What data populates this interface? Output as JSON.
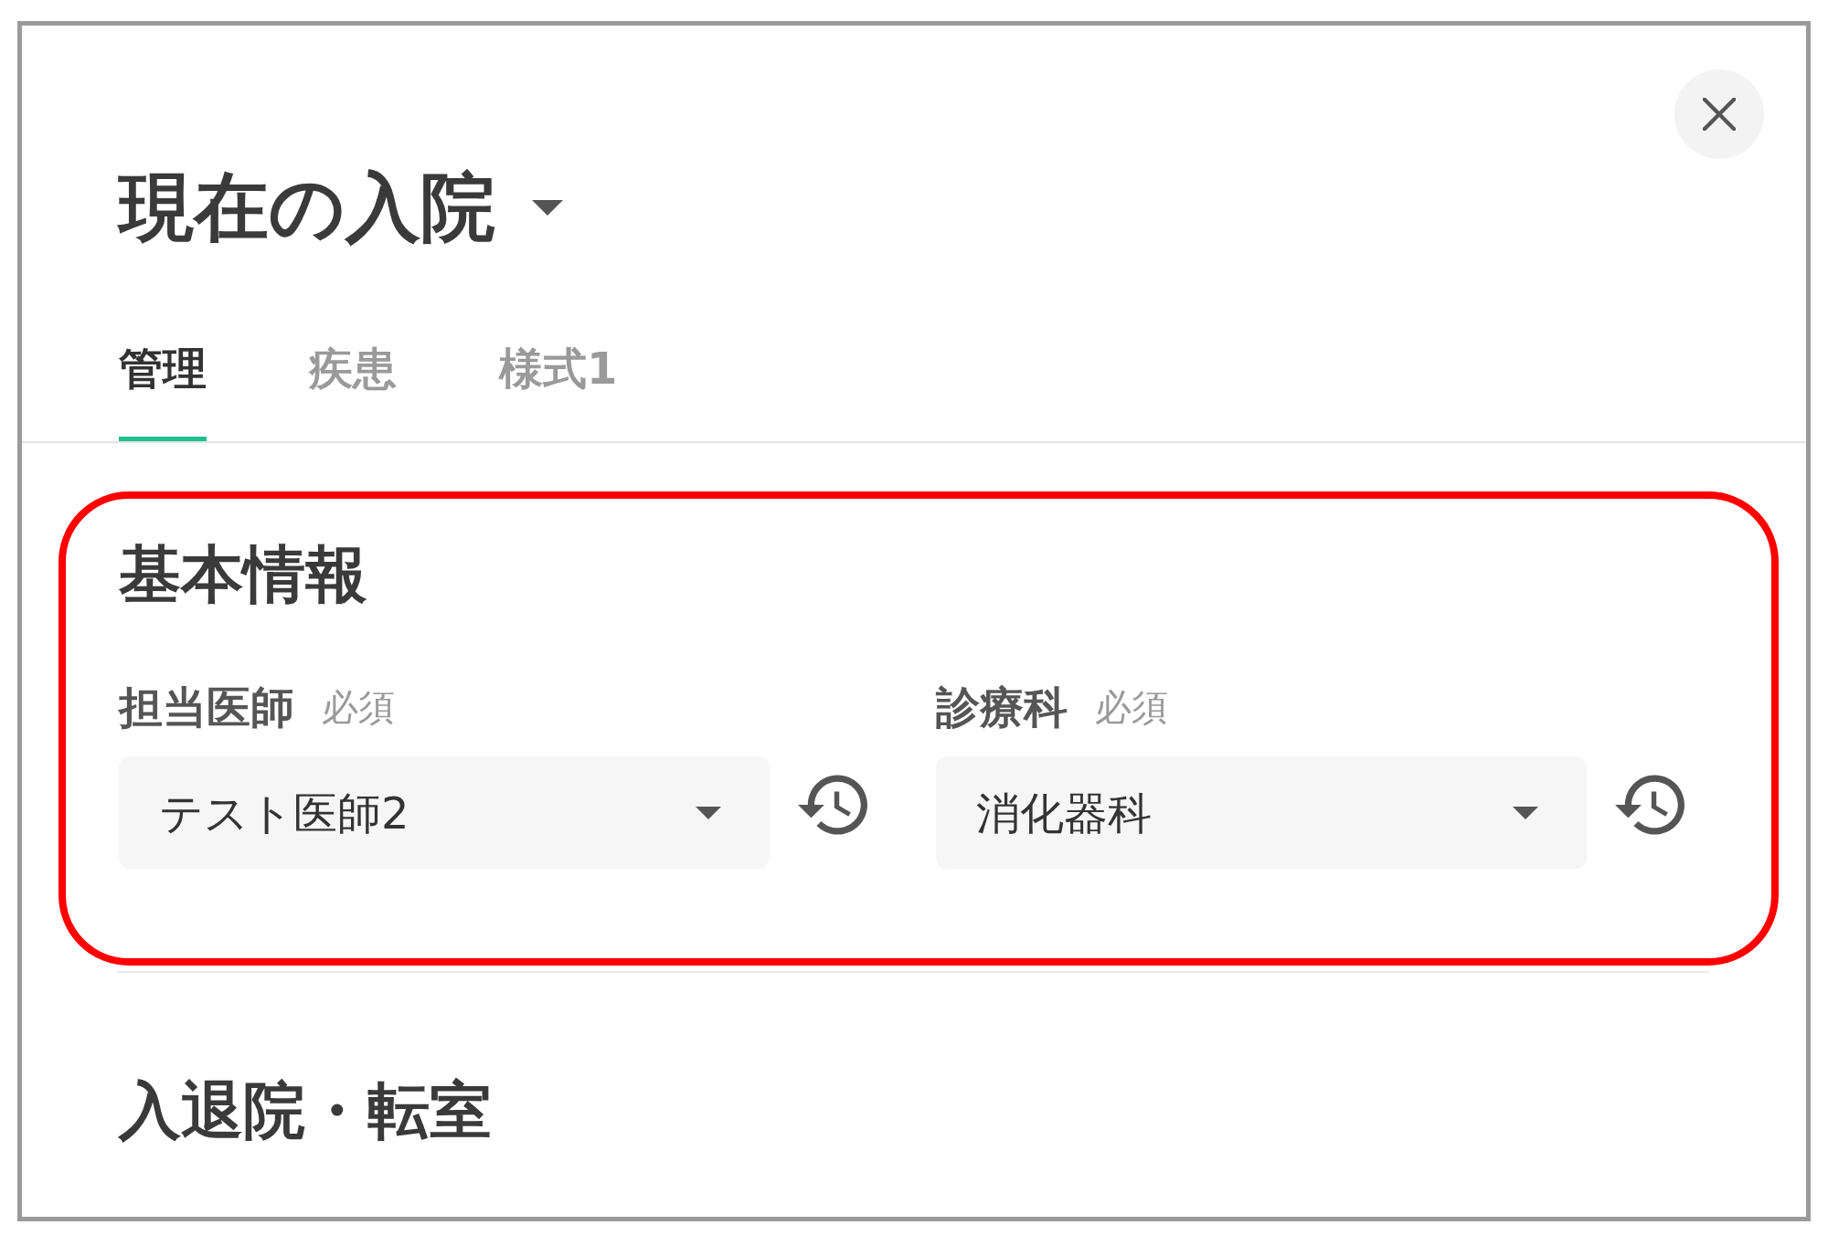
{
  "header": {
    "title": "現在の入院"
  },
  "tabs": [
    {
      "label": "管理",
      "selected": true
    },
    {
      "label": "疾患",
      "selected": false
    },
    {
      "label": "様式1",
      "selected": false
    }
  ],
  "sections": [
    {
      "title": "基本情報",
      "highlighted": true,
      "fields": [
        {
          "label": "担当医師",
          "required_tag": "必須",
          "value": "テスト医師2"
        },
        {
          "label": "診療科",
          "required_tag": "必須",
          "value": "消化器科"
        }
      ]
    },
    {
      "title": "入退院・転室"
    }
  ]
}
